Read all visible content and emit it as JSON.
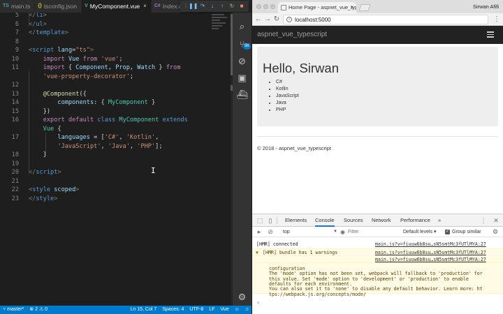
{
  "editor": {
    "tabs": [
      {
        "label": "main.ts",
        "icon": "TS"
      },
      {
        "label": "tsconfig.json",
        "icon": "{}"
      },
      {
        "label": "MyComponent.vue",
        "icon": "V"
      },
      {
        "label": "Index.cshtm",
        "icon": "C#"
      }
    ],
    "active_tab": "MyComponent.vue",
    "close_glyph": "×",
    "lines": [
      {
        "n": "5",
        "html": "<span class=\"p\">&lt;/</span><span class=\"t\">li</span><span class=\"p\">&gt;</span>"
      },
      {
        "n": "6",
        "html": "<span class=\"p\">&lt;/</span><span class=\"t\">ul</span><span class=\"p\">&gt;</span>"
      },
      {
        "n": "7",
        "html": "<span class=\"p\">&lt;/</span><span class=\"t\">template</span><span class=\"p\">&gt;</span>"
      },
      {
        "n": "8",
        "html": ""
      },
      {
        "n": "9",
        "html": "<span class=\"p\">&lt;</span><span class=\"t\">script</span> <span class=\"a\">lang</span>=<span class=\"s\">\"ts\"</span><span class=\"p\">&gt;</span>"
      },
      {
        "n": "10",
        "html": "    <span class=\"kc\">import</span> <span class=\"a\">Vue</span> <span class=\"kc\">from</span> <span class=\"s\">'vue'</span>;"
      },
      {
        "n": "11",
        "html": "    <span class=\"kc\">import</span> { <span class=\"a\">Component</span>, <span class=\"a\">Prop</span>, <span class=\"a\">Watch</span> } <span class=\"kc\">from</span>"
      },
      {
        "n": "",
        "html": "    <span class=\"s\">'vue-property-decorator'</span>;"
      },
      {
        "n": "12",
        "html": ""
      },
      {
        "n": "13",
        "html": "    <span class=\"f\">@Component</span>({"
      },
      {
        "n": "14",
        "html": "        <span class=\"a\">components</span>: { <span class=\"c\">MyComponent</span> }"
      },
      {
        "n": "15",
        "html": "    })"
      },
      {
        "n": "16",
        "html": "    <span class=\"kc\">export</span> <span class=\"kc\">default</span> <span class=\"k\">class</span> <span class=\"c\">MyComponent</span> <span class=\"k\">extends</span>"
      },
      {
        "n": "",
        "html": "    <span class=\"c\">Vue</span> {"
      },
      {
        "n": "17",
        "html": "        <span class=\"a\">languages</span> = [<span class=\"s\">'C#'</span>, <span class=\"s\">'Kotlin'</span>,"
      },
      {
        "n": "",
        "html": "        <span class=\"s\">'JavaScript'</span>, <span class=\"s\">'Java'</span>, <span class=\"s\">'PHP'</span>];"
      },
      {
        "n": "18",
        "html": "    }"
      },
      {
        "n": "19",
        "html": ""
      },
      {
        "n": "20",
        "html": "<span class=\"p\">&lt;/</span><span class=\"t\">script</span><span class=\"p\">&gt;</span>"
      },
      {
        "n": "21",
        "html": ""
      },
      {
        "n": "22",
        "html": "<span class=\"p\">&lt;</span><span class=\"t\">style</span> <span class=\"a\">scoped</span><span class=\"p\">&gt;</span>"
      },
      {
        "n": "23",
        "html": "<span class=\"p\">&lt;/</span><span class=\"t\">style</span><span class=\"p\">&gt;</span>"
      }
    ],
    "activity_badge": "5K",
    "status": {
      "branch": "master*",
      "errors": "2",
      "warnings": "0",
      "position": "Ln 15, Col 7",
      "spaces": "Spaces: 4",
      "encoding": "UTF-8",
      "eol": "LF",
      "language": "Vue"
    }
  },
  "browser": {
    "tab_title": "Home Page - aspnet_vue_typ",
    "user": "Sirwan Afifi",
    "url": "localhost:5000",
    "brand": "aspnet_vue_typescript",
    "heading": "Hello, Sirwan",
    "languages": [
      "C#",
      "Kotlin",
      "JavaScript",
      "Java",
      "PHP"
    ],
    "footer": "© 2018 - aspnet_vue_typescript"
  },
  "devtools": {
    "tabs": [
      "Elements",
      "Console",
      "Sources",
      "Network",
      "Performance"
    ],
    "active_tab": "Console",
    "more": "»",
    "context": "top",
    "filter_placeholder": "Filter",
    "levels": "Default levels ▾",
    "group_similar": "Group similar",
    "messages": [
      {
        "text": "[HMR] connected",
        "source": "main.js?v=fiuuw6b8su…sN5smtMc3fUTlMYA:27"
      },
      {
        "text": "[HMR] bundle has 1 warnings",
        "source": "main.js?v=fiuuw6b8su…sN5smtMc3fUTlMYA:27"
      }
    ],
    "warning_source": "main.js?v=fiuuw6b8su…sN5smtMc3fUTlMYA:27",
    "warning_lines": [
      "configuration",
      "The 'mode' option has not been set, webpack will fallback to 'production' for",
      "this value. Set 'mode' option to 'development' or 'production' to enable",
      "defaults for each environment.",
      "You can also set it to 'none' to disable any default behavior. Learn more: ht",
      "tps://webpack.js.org/concepts/mode/"
    ]
  }
}
